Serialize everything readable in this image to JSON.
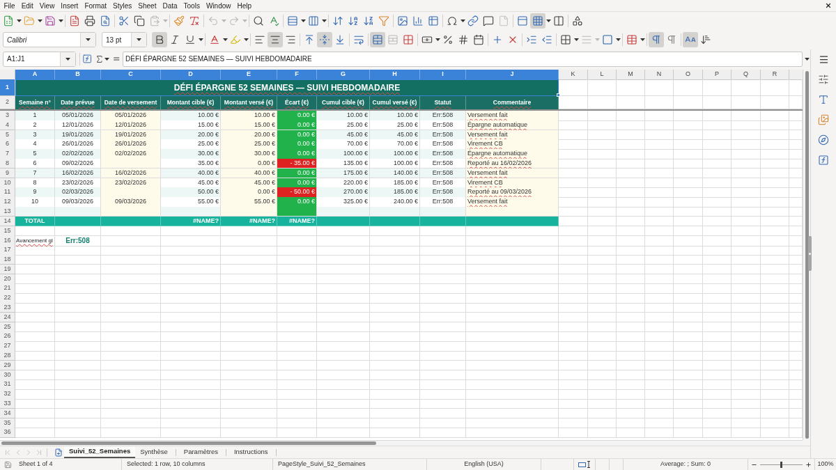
{
  "menu_bar": [
    "File",
    "Edit",
    "View",
    "Insert",
    "Format",
    "Styles",
    "Sheet",
    "Data",
    "Tools",
    "Window",
    "Help"
  ],
  "standard_toolbar": {
    "freeze_rows_columns": true
  },
  "formatting_toolbar": {
    "font_name": "Calibri",
    "font_size": "13 pt",
    "bold": true,
    "italic": false,
    "underline": false,
    "align_left": false,
    "align_center": true,
    "align_right": false,
    "align_top": false,
    "align_middle": true,
    "align_bottom": false,
    "wrap_text": false,
    "merge_and_center": true,
    "paragraph_left_to_right": true,
    "paragraph_right_to_left": false,
    "text_horizontal": true,
    "text_vertical": false
  },
  "formula_bar": {
    "name_box": "A1:J1",
    "content": "DÉFI ÉPARGNE 52 SEMAINES — SUIVI HEBDOMADAIRE"
  },
  "sheet": {
    "column_headers": [
      {
        "label": "A",
        "selected": true
      },
      {
        "label": "B",
        "selected": true
      },
      {
        "label": "C",
        "selected": true
      },
      {
        "label": "D",
        "selected": true
      },
      {
        "label": "E",
        "selected": true
      },
      {
        "label": "F",
        "selected": true
      },
      {
        "label": "G",
        "selected": true
      },
      {
        "label": "H",
        "selected": true
      },
      {
        "label": "I",
        "selected": true
      },
      {
        "label": "J",
        "selected": true
      },
      {
        "label": "K",
        "selected": false
      },
      {
        "label": "L",
        "selected": false
      },
      {
        "label": "M",
        "selected": false
      },
      {
        "label": "N",
        "selected": false
      },
      {
        "label": "O",
        "selected": false
      },
      {
        "label": "P",
        "selected": false
      },
      {
        "label": "Q",
        "selected": false
      },
      {
        "label": "R",
        "selected": false
      }
    ],
    "row_headers": [
      {
        "label": "1",
        "selected": true
      },
      {
        "label": "2",
        "selected": false
      },
      {
        "label": "3",
        "selected": false
      },
      {
        "label": "4",
        "selected": false
      },
      {
        "label": "5",
        "selected": false
      },
      {
        "label": "6",
        "selected": false
      },
      {
        "label": "7",
        "selected": false
      },
      {
        "label": "8",
        "selected": false
      },
      {
        "label": "9",
        "selected": false
      },
      {
        "label": "10",
        "selected": false
      },
      {
        "label": "11",
        "selected": false
      },
      {
        "label": "12",
        "selected": false
      },
      {
        "label": "13",
        "selected": false
      },
      {
        "label": "14",
        "selected": false
      },
      {
        "label": "15",
        "selected": false
      },
      {
        "label": "16",
        "selected": false
      },
      {
        "label": "17",
        "selected": false
      },
      {
        "label": "18",
        "selected": false
      },
      {
        "label": "19",
        "selected": false
      },
      {
        "label": "20",
        "selected": false
      },
      {
        "label": "21",
        "selected": false
      },
      {
        "label": "22",
        "selected": false
      },
      {
        "label": "23",
        "selected": false
      },
      {
        "label": "24",
        "selected": false
      },
      {
        "label": "25",
        "selected": false
      },
      {
        "label": "26",
        "selected": false
      },
      {
        "label": "27",
        "selected": false
      },
      {
        "label": "28",
        "selected": false
      },
      {
        "label": "29",
        "selected": false
      },
      {
        "label": "30",
        "selected": false
      },
      {
        "label": "31",
        "selected": false
      },
      {
        "label": "32",
        "selected": false
      },
      {
        "label": "33",
        "selected": false
      },
      {
        "label": "34",
        "selected": false
      },
      {
        "label": "35",
        "selected": false
      },
      {
        "label": "36",
        "selected": false
      }
    ],
    "title": "DÉFI ÉPARGNE 52 SEMAINES — SUIVI HEBDOMADAIRE",
    "headers": [
      "Semaine n°",
      "Date prévue",
      "Date de versement",
      "Montant cible (€)",
      "Montant versé (€)",
      "Écart (€)",
      "Cumul cible (€)",
      "Cumul versé (€)",
      "Statut",
      "Commentaire"
    ],
    "rows": [
      {
        "week": "1",
        "planned_date": "05/01/2026",
        "payment_date": "05/01/2026",
        "target": "10.00 €",
        "paid": "10.00 €",
        "gap": {
          "text": "0.00 €",
          "color": "#22b24c"
        },
        "cumulative_target": "10.00 €",
        "cumulative_paid": "10.00 €",
        "status": "Err:508",
        "comment": "Versement fait"
      },
      {
        "week": "2",
        "planned_date": "12/01/2026",
        "payment_date": "12/01/2026",
        "target": "15.00 €",
        "paid": "15.00 €",
        "gap": {
          "text": "0.00 €",
          "color": "#22b24c"
        },
        "cumulative_target": "25.00 €",
        "cumulative_paid": "25.00 €",
        "status": "Err:508",
        "comment": "Épargne automatique"
      },
      {
        "week": "3",
        "planned_date": "19/01/2026",
        "payment_date": "19/01/2026",
        "target": "20.00 €",
        "paid": "20.00 €",
        "gap": {
          "text": "0.00 €",
          "color": "#22b24c"
        },
        "cumulative_target": "45.00 €",
        "cumulative_paid": "45.00 €",
        "status": "Err:508",
        "comment": "Versement fait"
      },
      {
        "week": "4",
        "planned_date": "26/01/2026",
        "payment_date": "26/01/2026",
        "target": "25.00 €",
        "paid": "25.00 €",
        "gap": {
          "text": "0.00 €",
          "color": "#22b24c"
        },
        "cumulative_target": "70.00 €",
        "cumulative_paid": "70.00 €",
        "status": "Err:508",
        "comment": "Virement CB"
      },
      {
        "week": "5",
        "planned_date": "02/02/2026",
        "payment_date": "02/02/2026",
        "target": "30.00 €",
        "paid": "30.00 €",
        "gap": {
          "text": "0.00 €",
          "color": "#22b24c"
        },
        "cumulative_target": "100.00 €",
        "cumulative_paid": "100.00 €",
        "status": "Err:508",
        "comment": "Épargne automatique"
      },
      {
        "week": "6",
        "planned_date": "09/02/2026",
        "target": "35.00 €",
        "paid": "0.00 €",
        "gap": {
          "text": "- 35.00 €",
          "color": "#de2222"
        },
        "cumulative_target": "135.00 €",
        "cumulative_paid": "100.00 €",
        "status": "Err:508",
        "comment": "Reporté au 16/02/2026"
      },
      {
        "week": "7",
        "planned_date": "16/02/2026",
        "payment_date": "16/02/2026",
        "target": "40.00 €",
        "paid": "40.00 €",
        "gap": {
          "text": "0.00 €",
          "color": "#22b24c"
        },
        "cumulative_target": "175.00 €",
        "cumulative_paid": "140.00 €",
        "status": "Err:508",
        "comment": "Versement fait"
      },
      {
        "week": "8",
        "planned_date": "23/02/2026",
        "payment_date": "23/02/2026",
        "target": "45.00 €",
        "paid": "45.00 €",
        "gap": {
          "text": "0.00 €",
          "color": "#22b24c"
        },
        "cumulative_target": "220.00 €",
        "cumulative_paid": "185.00 €",
        "status": "Err:508",
        "comment": "Virement CB"
      },
      {
        "week": "9",
        "planned_date": "02/03/2026",
        "target": "50.00 €",
        "paid": "0.00 €",
        "gap": {
          "text": "- 50.00 €",
          "color": "#de2222"
        },
        "cumulative_target": "270.00 €",
        "cumulative_paid": "185.00 €",
        "status": "Err:508",
        "comment": "Reporté au 09/03/2026"
      },
      {
        "week": "10",
        "planned_date": "09/03/2026",
        "payment_date": "09/03/2026",
        "target": "55.00 €",
        "paid": "55.00 €",
        "gap": {
          "text": "0.00 €",
          "color": "#22b24c"
        },
        "cumulative_target": "325.00 €",
        "cumulative_paid": "240.00 €",
        "status": "Err:508",
        "comment": "Versement fait"
      },
      {
        "gap": {
          "color": "#22b24c"
        }
      }
    ],
    "total_row": {
      "label": "TOTAL",
      "target": "#NAME?",
      "paid": "#NAME?",
      "gap": "#NAME?"
    },
    "progress_row": {
      "label": "Avancement gl",
      "value": "Err:508"
    }
  },
  "sheet_tabs": [
    {
      "label": "Suivi_52_Semaines",
      "selected": true
    },
    {
      "label": "Synthèse",
      "selected": false
    },
    {
      "label": "Paramètres",
      "selected": false
    },
    {
      "label": "Instructions",
      "selected": false
    }
  ],
  "status_bar": {
    "sheet": "Sheet 1 of 4",
    "selection": "Selected: 1 row, 10 columns",
    "page_style": "PageStyle_Suivi_52_Semaines",
    "language": "English (USA)",
    "statistics": "Average: ; Sum: 0",
    "zoom_slider": {
      "level": 0.5
    },
    "zoom": "100%"
  }
}
